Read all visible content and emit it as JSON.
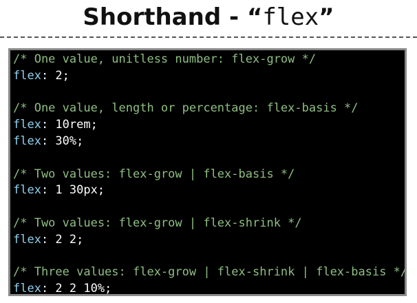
{
  "header": {
    "title_text": "Shorthand - ",
    "open_quote": "“",
    "keyword": "flex",
    "close_quote": "”"
  },
  "code_panel": {
    "lines": [
      {
        "comment": "/* One value, unitless number: flex-grow */"
      },
      {
        "property": "flex",
        "value": ": 2;"
      },
      {
        "blank": true
      },
      {
        "comment": "/* One value, length or percentage: flex-basis */"
      },
      {
        "property": "flex",
        "value": ": 10rem;"
      },
      {
        "property": "flex",
        "value": ": 30%;"
      },
      {
        "blank": true
      },
      {
        "comment": "/* Two values: flex-grow | flex-basis */"
      },
      {
        "property": "flex",
        "value": ": 1 30px;"
      },
      {
        "blank": true
      },
      {
        "comment": "/* Two values: flex-grow | flex-shrink */"
      },
      {
        "property": "flex",
        "value": ": 2 2;"
      },
      {
        "blank": true
      },
      {
        "comment": "/* Three values: flex-grow | flex-shrink | flex-basis */"
      },
      {
        "property": "flex",
        "value": ": 2 2 10%;"
      }
    ]
  },
  "colors": {
    "comment": "#8fbf82",
    "property": "#8fd0ee",
    "value": "#ffffff",
    "panel_background": "#000000",
    "panel_border": "#8a8a8a"
  }
}
